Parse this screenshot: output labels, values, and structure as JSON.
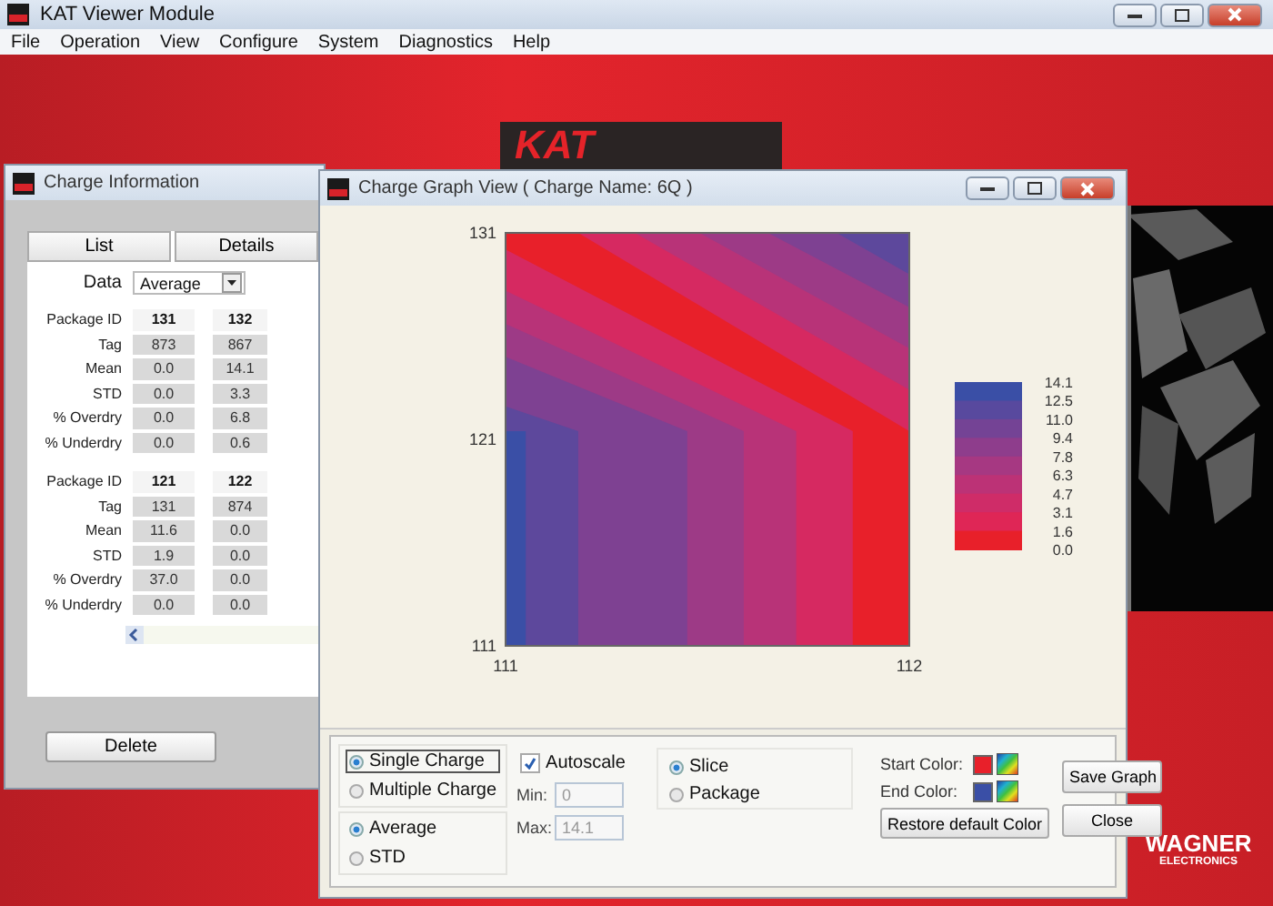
{
  "app": {
    "title": "KAT Viewer Module",
    "menu": [
      "File",
      "Operation",
      "View",
      "Configure",
      "System",
      "Diagnostics",
      "Help"
    ]
  },
  "desktop": {
    "logo": "KAT",
    "brand": "WAGNER",
    "brand_sub": "ELECTRONICS"
  },
  "charge_info": {
    "title": "Charge Information",
    "tabs": [
      "List",
      "Details"
    ],
    "data_select": {
      "label": "Data",
      "value": "Average"
    },
    "blocks": [
      {
        "header": "Package ID",
        "ids": [
          "131",
          "132"
        ],
        "rows": [
          {
            "label": "Tag",
            "values": [
              "873",
              "867"
            ]
          },
          {
            "label": "Mean",
            "values": [
              "0.0",
              "14.1"
            ]
          },
          {
            "label": "STD",
            "values": [
              "0.0",
              "3.3"
            ]
          },
          {
            "label": "% Overdry",
            "values": [
              "0.0",
              "6.8"
            ]
          },
          {
            "label": "% Underdry",
            "values": [
              "0.0",
              "0.6"
            ]
          }
        ]
      },
      {
        "header": "Package ID",
        "ids": [
          "121",
          "122"
        ],
        "rows": [
          {
            "label": "Tag",
            "values": [
              "131",
              "874"
            ]
          },
          {
            "label": "Mean",
            "values": [
              "11.6",
              "0.0"
            ]
          },
          {
            "label": "STD",
            "values": [
              "1.9",
              "0.0"
            ]
          },
          {
            "label": "% Overdry",
            "values": [
              "37.0",
              "0.0"
            ]
          },
          {
            "label": "% Underdry",
            "values": [
              "0.0",
              "0.0"
            ]
          }
        ]
      }
    ],
    "delete_button": "Delete"
  },
  "graph": {
    "title": "Charge Graph View ( Charge Name:  6Q )",
    "y_labels": [
      "131",
      "121",
      "111"
    ],
    "x_labels": [
      "111",
      "112"
    ],
    "scale_labels": [
      "14.1",
      "12.5",
      "11.0",
      "9.4",
      "7.8",
      "6.3",
      "4.7",
      "3.1",
      "1.6",
      "0.0"
    ],
    "charge_mode": [
      {
        "label": "Single Charge",
        "selected": true
      },
      {
        "label": "Multiple Charge",
        "selected": false
      }
    ],
    "statistic": [
      {
        "label": "Average",
        "selected": true
      },
      {
        "label": "STD",
        "selected": false
      }
    ],
    "autoscale": {
      "label": "Autoscale",
      "checked": true
    },
    "range": [
      {
        "label": "Min:",
        "value": "0",
        "disabled": true
      },
      {
        "label": "Max:",
        "value": "14.1",
        "disabled": true
      }
    ],
    "view_by": [
      {
        "label": "Slice",
        "selected": true
      },
      {
        "label": "Package",
        "selected": false
      }
    ],
    "colors": [
      {
        "label": "Start Color:",
        "color": "#e8202a"
      },
      {
        "label": "End Color:",
        "color": "#3a4fa6"
      }
    ],
    "restore_button": "Restore default Color",
    "buttons": [
      "Save Graph",
      "Close"
    ]
  }
}
